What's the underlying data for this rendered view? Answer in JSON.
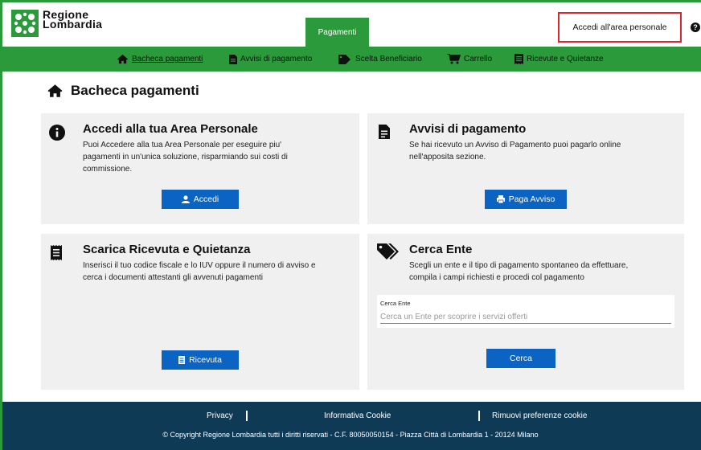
{
  "header": {
    "logo_line1": "Regione",
    "logo_line2": "Lombardia",
    "tab_label": "Pagamenti",
    "login_label": "Accedi all'area personale",
    "help_glyph": "?"
  },
  "nav": {
    "items": [
      {
        "label": "Bacheca pagamenti",
        "icon": "home-icon",
        "active": true
      },
      {
        "label": "Avvisi di pagamento",
        "icon": "document-icon"
      },
      {
        "label": "Scelta Beneficiario",
        "icon": "tag-icon"
      },
      {
        "label": "Carrello",
        "icon": "cart-icon"
      },
      {
        "label": "Ricevute e Quietanze",
        "icon": "receipt-icon"
      }
    ]
  },
  "page": {
    "title": "Bacheca pagamenti"
  },
  "cards": {
    "area_personale": {
      "title": "Accedi alla tua Area Personale",
      "desc": [
        "Puoi Accedere alla tua Area Personale per eseguire piu'",
        "pagamenti in un'unica soluzione, risparmiando sui costi di",
        "commissione."
      ],
      "button": "Accedi",
      "icon": "info-icon"
    },
    "avvisi": {
      "title": "Avvisi di pagamento",
      "desc": [
        "Se hai ricevuto un Avviso di Pagamento puoi pagarlo online",
        "nell'apposita sezione."
      ],
      "button": "Paga Avviso",
      "icon": "document-icon"
    },
    "ricevuta": {
      "title": "Scarica Ricevuta e Quietanza",
      "desc": [
        "Inserisci il tuo codice fiscale e lo IUV oppure il numero di avviso e",
        "cerca i documenti attestanti gli avvenuti pagamenti"
      ],
      "button": "Ricevuta",
      "icon": "receipt-icon"
    },
    "cerca_ente": {
      "title": "Cerca Ente",
      "desc": [
        "Scegli un ente e il tipo di pagamento spontaneo da effettuare,",
        "compila i campi richiesti e procedi col pagamento"
      ],
      "search_label": "Cerca Ente",
      "search_placeholder": "Cerca un Ente per scoprire i servizi offerti",
      "search_value": "",
      "button": "Cerca",
      "icon": "tag-icon"
    }
  },
  "footer": {
    "privacy": "Privacy",
    "cookie_info": "Informativa Cookie",
    "cookie_remove": "Rimuovi preferenze cookie",
    "copyright": "© Copyright Regione Lombardia tutti i diritti riservati - C.F. 80050050154 - Piazza Città di Lombardia 1 - 20124 Milano"
  },
  "colors": {
    "brand_green": "#2a9a3a",
    "button_blue": "#0b63c4",
    "footer_navy": "#0e3a56",
    "highlight_red": "#e0262d"
  }
}
